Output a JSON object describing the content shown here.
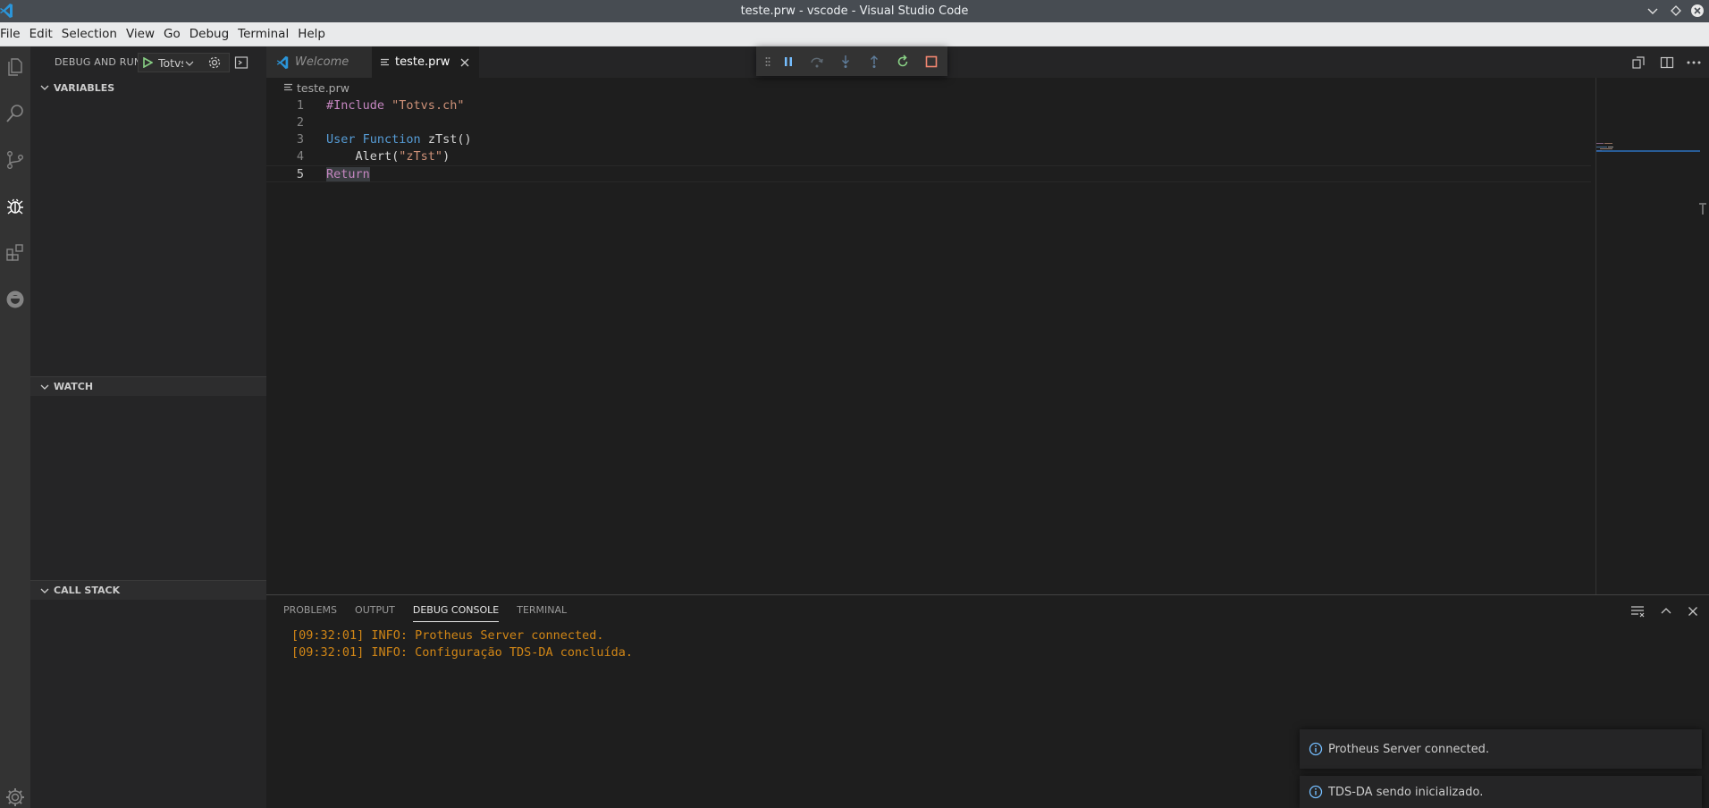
{
  "window": {
    "title": "teste.prw - vscode - Visual Studio Code"
  },
  "menu": [
    "File",
    "Edit",
    "Selection",
    "View",
    "Go",
    "Debug",
    "Terminal",
    "Help"
  ],
  "activity_bar": {
    "items": [
      "explorer-icon",
      "search-icon",
      "source-control-icon",
      "debug-icon",
      "extensions-icon",
      "totvs-icon"
    ],
    "active": "debug-icon",
    "bottom": "gear-icon"
  },
  "sidebar": {
    "title": "DEBUG AND RUN",
    "config_value": "Totvs",
    "sections": {
      "variables": "VARIABLES",
      "watch": "WATCH",
      "call_stack": "CALL STACK"
    }
  },
  "editor": {
    "tabs": [
      {
        "label": "Welcome",
        "active": false
      },
      {
        "label": "teste.prw",
        "active": true
      }
    ],
    "breadcrumb": "teste.prw",
    "line_numbers": [
      "1",
      "2",
      "3",
      "4",
      "5"
    ],
    "lines": {
      "l1_directive": "#Include",
      "l1_string": "\"Totvs.ch\"",
      "l3_keyword": "User Function",
      "l3_name": "zTst()",
      "l4_indent": "    ",
      "l4_call": "Alert(",
      "l4_string": "\"zTst\"",
      "l4_close": ")",
      "l5_return": "Return"
    }
  },
  "debug_toolbar": [
    "grip-icon",
    "pause-icon",
    "step-over-icon",
    "step-into-icon",
    "step-out-icon",
    "restart-icon",
    "stop-icon"
  ],
  "panel": {
    "tabs": [
      "PROBLEMS",
      "OUTPUT",
      "DEBUG CONSOLE",
      "TERMINAL"
    ],
    "active_tab": "DEBUG CONSOLE",
    "console_lines": [
      "[09:32:01] INFO: Protheus Server connected.",
      "[09:32:01] INFO: Configuração TDS-DA concluída."
    ]
  },
  "notifications": [
    "Protheus Server connected.",
    "TDS-DA sendo inicializado."
  ],
  "colors": {
    "accent": "#007acc",
    "console_text": "#d18616",
    "play_green": "#89d185",
    "stop_red": "#f48771"
  }
}
